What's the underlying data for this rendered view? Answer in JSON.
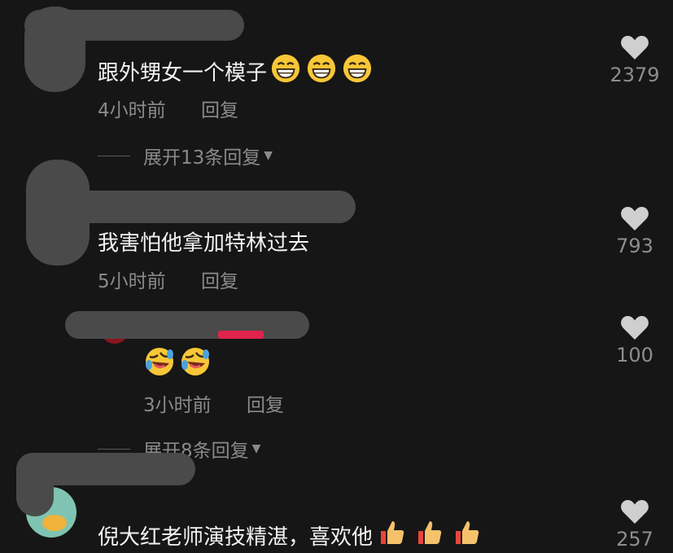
{
  "comments": [
    {
      "text": "跟外甥女一个模子",
      "time": "4小时前",
      "reply": "回复",
      "likes": "2379",
      "expand": "展开13条回复",
      "emoji": "grinning-face"
    },
    {
      "text": "我害怕他拿加特林过去",
      "time": "5小时前",
      "reply": "回复",
      "likes": "793"
    },
    {
      "text": "",
      "time": "3小时前",
      "reply": "回复",
      "likes": "100",
      "expand": "展开8条回复",
      "emoji": "rolling-laughing-face"
    },
    {
      "text": "倪大红老师演技精湛，喜欢他",
      "likes": "257",
      "emoji": "thumbs-up"
    }
  ],
  "colors": {
    "background": "#161616",
    "text": "#f2f2f2",
    "meta": "#8a8a8a",
    "like_icon": "#cfcfcf",
    "redaction": "#4a4a4a"
  }
}
